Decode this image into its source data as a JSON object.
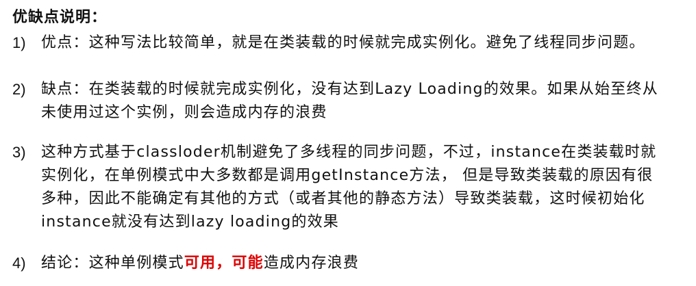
{
  "heading": "优缺点说明：",
  "items": [
    {
      "number": "1)",
      "text": "优点：这种写法比较简单，就是在类装载的时候就完成实例化。避免了线程同步问题。"
    },
    {
      "number": "2)",
      "text": "缺点：在类装载的时候就完成实例化，没有达到Lazy Loading的效果。如果从始至终从未使用过这个实例，则会造成内存的浪费"
    },
    {
      "number": "3)",
      "text": "这种方式基于classloder机制避免了多线程的同步问题，不过，instance在类装载时就实例化，在单例模式中大多数都是调用getInstance方法， 但是导致类装载的原因有很多种，因此不能确定有其他的方式（或者其他的静态方法）导致类装载，这时候初始化instance就没有达到lazy loading的效果"
    },
    {
      "number": "4)",
      "text_before": "结论：这种单例模式",
      "highlight_1": "可用",
      "separator": "，",
      "highlight_2": "可能",
      "text_after": "造成内存浪费"
    }
  ],
  "colors": {
    "text": "#111111",
    "highlight": "#e00000",
    "background": "#ffffff"
  }
}
